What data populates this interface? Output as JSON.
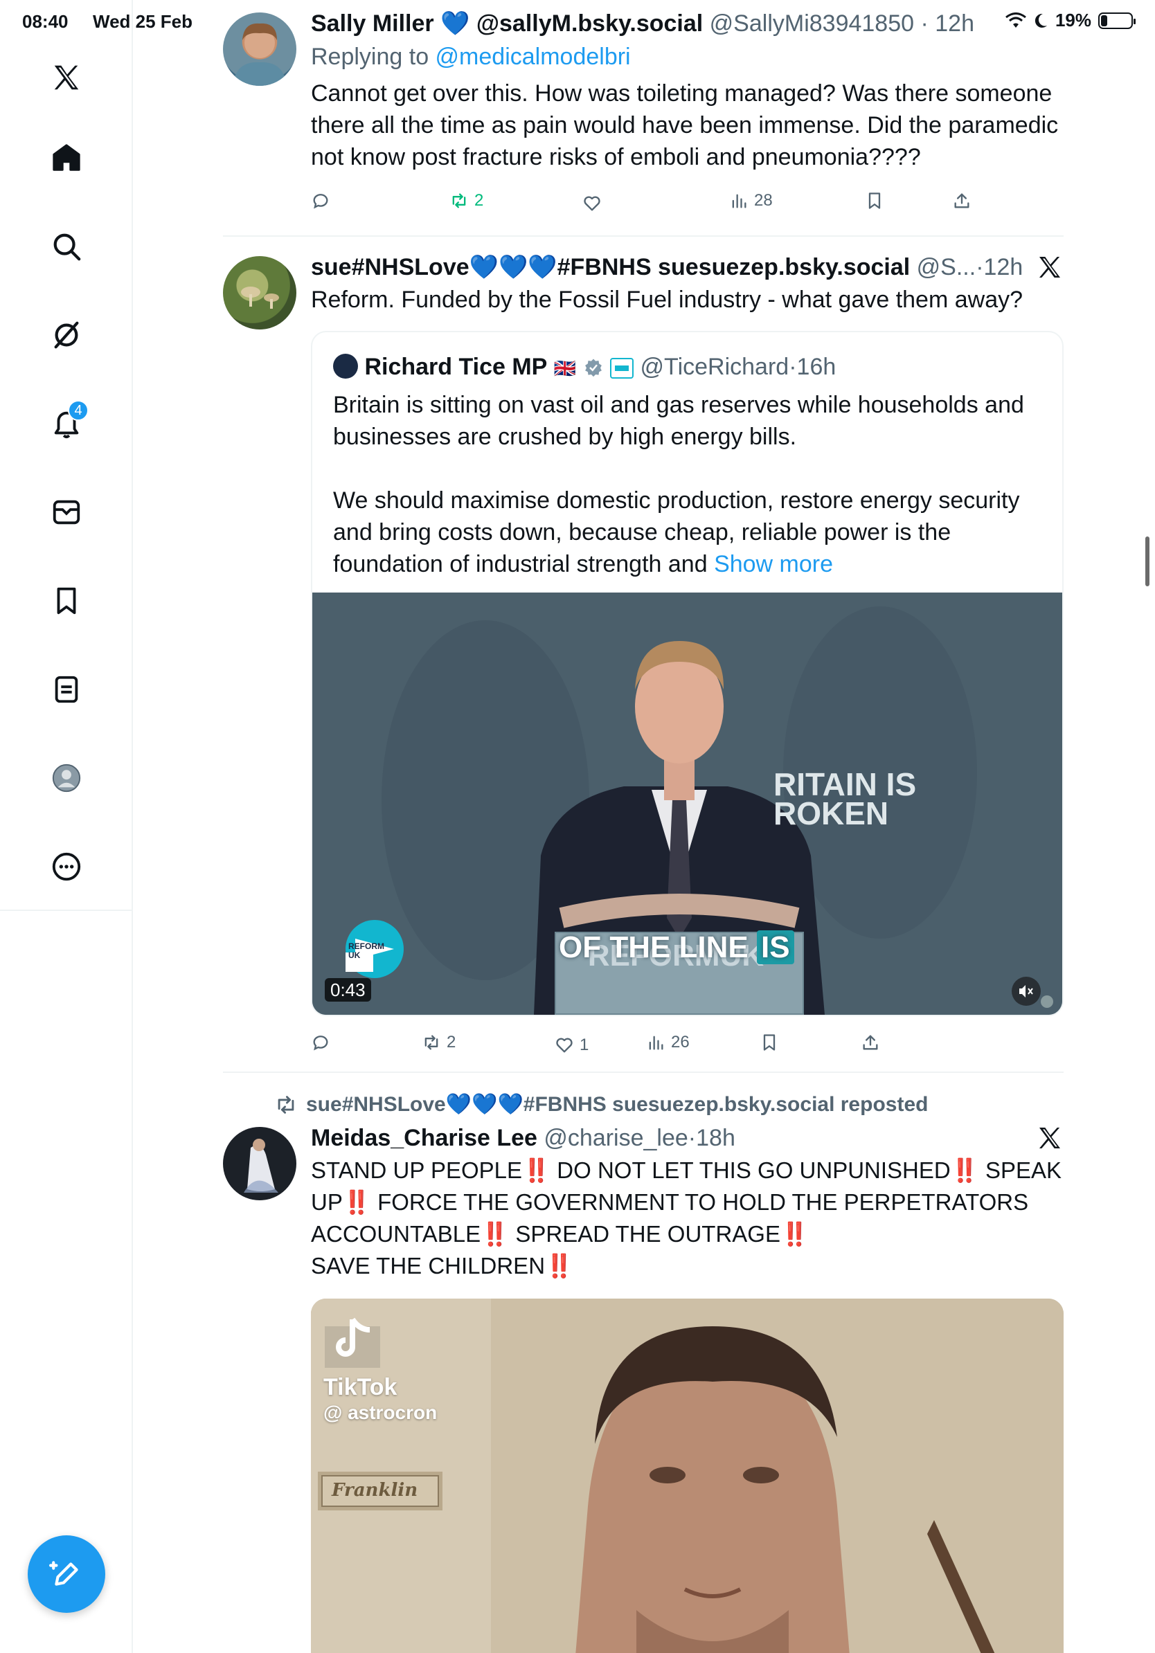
{
  "status_bar": {
    "time": "08:40",
    "date": "Wed 25 Feb",
    "battery": "19%",
    "battery_level": 0.19
  },
  "sidebar": {
    "items": [
      {
        "name": "x-logo-icon"
      },
      {
        "name": "home-icon"
      },
      {
        "name": "search-icon"
      },
      {
        "name": "grok-icon"
      },
      {
        "name": "notifications-icon",
        "badge": "4"
      },
      {
        "name": "messages-icon"
      },
      {
        "name": "bookmarks-icon"
      },
      {
        "name": "lists-icon"
      },
      {
        "name": "profile-icon"
      },
      {
        "name": "more-icon"
      }
    ],
    "compose": "compose-icon"
  },
  "tweets": [
    {
      "name": "Sally Miller 💙 @sallyM.bsky.social",
      "handle": "@SallyMi83941850",
      "time": "12h",
      "replying_prefix": "Replying to ",
      "replying_to": "@medicalmodelbri",
      "text": "Cannot get over this. How was toileting managed? Was there someone there all the time as pain would have been immense. Did the paramedic not know post fracture risks of emboli and pneumonia????",
      "retweets": "2",
      "views": "28"
    },
    {
      "name": "sue#NHSLove💙💙💙#FBNHS suesuezep.bsky.social",
      "handle": "@S...",
      "time": "12h",
      "text": "Reform. Funded by the Fossil Fuel industry - what gave them away?",
      "quote": {
        "name": "Richard Tice MP",
        "flag": "🇬🇧",
        "handle": "@TiceRichard",
        "time": "16h",
        "text1": "Britain is sitting on vast oil and gas reserves while households and businesses are crushed by high energy bills.",
        "text2": "We should maximise domestic production, restore energy security and bring costs down, because cheap, reliable power is the foundation of industrial strength and",
        "show_more": "Show more",
        "video_time": "0:43",
        "banner1": "RITAIN IS",
        "banner2": "ROKEN",
        "caption": "OF THE LINE",
        "caption_highlight": "IS",
        "podium": "REFORMUK",
        "logo": "REFORM UK"
      },
      "retweets": "2",
      "likes": "1",
      "views": "26"
    },
    {
      "repost_label": "sue#NHSLove💙💙💙#FBNHS suesuezep.bsky.social reposted",
      "name": "Meidas_Charise Lee",
      "handle": "@charise_lee",
      "time": "18h",
      "lines": [
        "STAND UP PEOPLE‼️ DO NOT LET THIS GO UNPUNISHED‼️ SPEAK",
        "UP‼️ FORCE THE GOVERNMENT TO HOLD THE PERPETRATORS",
        "ACCOUNTABLE‼️ SPREAD THE OUTRAGE‼️",
        "SAVE THE CHILDREN‼️"
      ],
      "media": {
        "tiktok": "TikTok",
        "tiktok_user": "@ astrocron",
        "sign": "Franklin"
      }
    }
  ],
  "colors": {
    "accent": "#1d9bf0",
    "retweet_active": "#00ba7c",
    "secondary": "#536471"
  }
}
